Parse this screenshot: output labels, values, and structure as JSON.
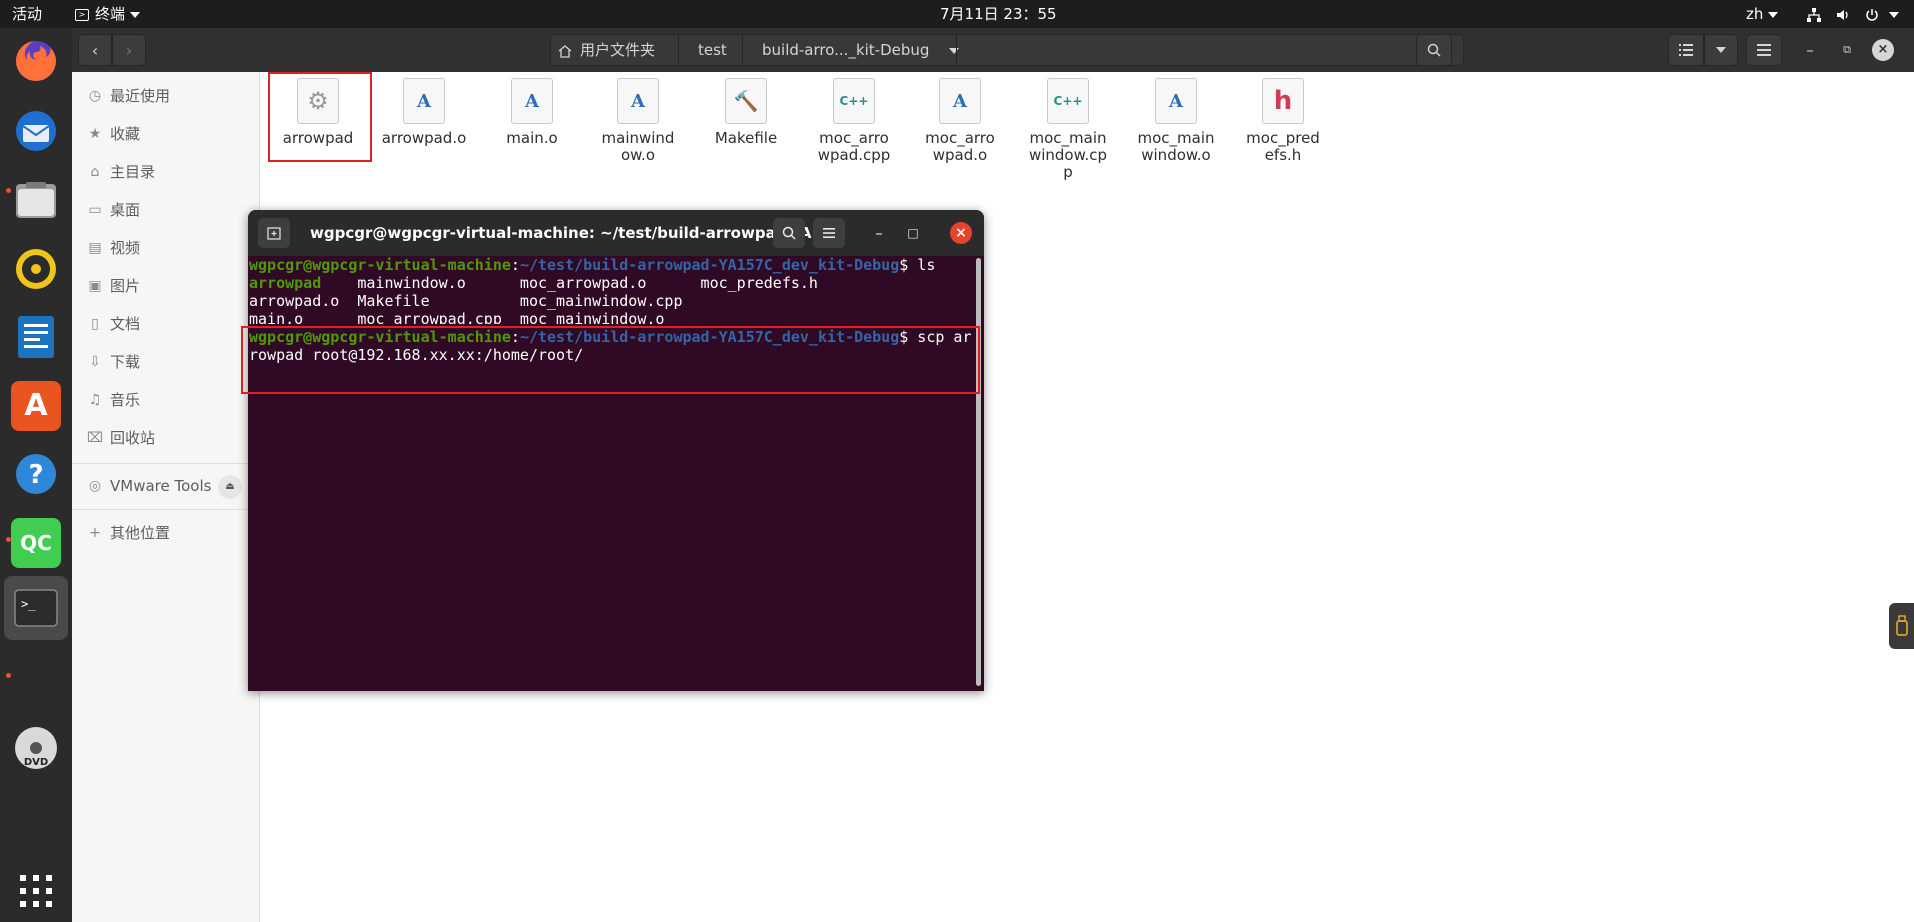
{
  "topbar": {
    "activities": "活动",
    "app_name": "终端",
    "clock": "7月11日 23：55",
    "lang": "zh"
  },
  "dock": {
    "apps": [
      "firefox-icon",
      "thunderbird-icon",
      "files-icon",
      "rhythmbox-icon",
      "writer-icon",
      "software-icon",
      "help-icon",
      "qtcreator-icon",
      "terminal-icon",
      "dvd-icon",
      "show-apps-icon"
    ],
    "qt_label": "QC",
    "help_label": "?",
    "dvd_label": "DVD"
  },
  "header": {
    "crumbs": [
      "用户文件夹",
      "test",
      "build-arro..._kit-Debug"
    ]
  },
  "sidebar": {
    "items": [
      {
        "icon": "recent-icon",
        "label": "最近使用"
      },
      {
        "icon": "star-icon",
        "label": "收藏"
      },
      {
        "icon": "home-icon",
        "label": "主目录"
      },
      {
        "icon": "desktop-icon",
        "label": "桌面"
      },
      {
        "icon": "video-icon",
        "label": "视频"
      },
      {
        "icon": "picture-icon",
        "label": "图片"
      },
      {
        "icon": "document-icon",
        "label": "文档"
      },
      {
        "icon": "download-icon",
        "label": "下载"
      },
      {
        "icon": "music-icon",
        "label": "音乐"
      },
      {
        "icon": "trash-icon",
        "label": "回收站"
      }
    ],
    "vmware": "VMware Tools",
    "other": "其他位置"
  },
  "files": [
    {
      "name": "arrowpad",
      "type": "executable",
      "glyph": "⚙"
    },
    {
      "name": "arrowpad.o",
      "type": "object",
      "glyph": "A"
    },
    {
      "name": "main.o",
      "type": "object",
      "glyph": "A"
    },
    {
      "name": "mainwindow.o",
      "type": "object",
      "glyph": "A"
    },
    {
      "name": "Makefile",
      "type": "makefile",
      "glyph": "🔨"
    },
    {
      "name": "moc_arrowpad.cpp",
      "type": "cpp",
      "glyph": "C++"
    },
    {
      "name": "moc_arrowpad.o",
      "type": "object",
      "glyph": "A"
    },
    {
      "name": "moc_mainwindow.cpp",
      "type": "cpp",
      "glyph": "C++"
    },
    {
      "name": "moc_mainwindow.o",
      "type": "object",
      "glyph": "A"
    },
    {
      "name": "moc_predefs.h",
      "type": "header",
      "glyph": "h"
    }
  ],
  "terminal": {
    "title": "wgpcgr@wgpcgr-virtual-machine: ~/test/build-arrowpad-YA1...",
    "prompt_user": "wgpcgr@wgpcgr-virtual-machine",
    "prompt_path": "~/test/build-arrowpad-YA157C_dev_kit-Debug",
    "cmd1": "$ ls",
    "ls_row1_exec": "arrowpad",
    "ls_row1_rest": "    mainwindow.o      moc_arrowpad.o      moc_predefs.h",
    "ls_row2": "arrowpad.o  Makefile          moc_mainwindow.cpp",
    "ls_row3": "main.o      moc_arrowpad.cpp  moc_mainwindow.o",
    "cmd2_part1": "$ scp ar",
    "cmd2_part2": "rowpad root@192.168.xx.xx:/home/root/"
  },
  "colors": {
    "terminal_bg": "#300a24",
    "prompt_green": "#4e9a06",
    "prompt_blue": "#3465a4",
    "highlight_red": "#e0201e"
  }
}
